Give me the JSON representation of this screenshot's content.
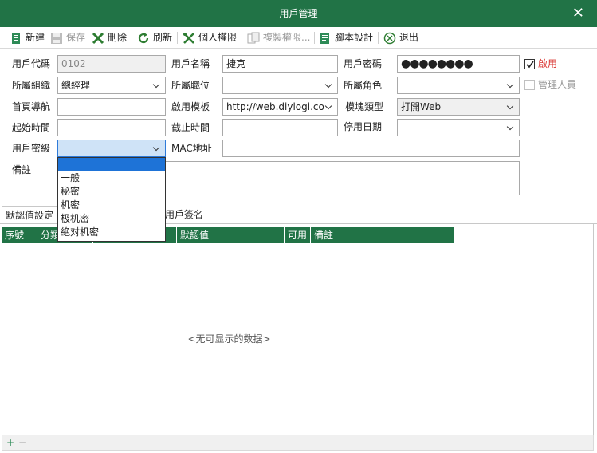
{
  "window": {
    "title": "用戶管理"
  },
  "toolbar": {
    "new": "新建",
    "save": "保存",
    "delete": "刪除",
    "refresh": "刷新",
    "personal_perm": "個人權限",
    "copy_perm": "複製權限...",
    "script_design": "腳本設計",
    "exit": "退出"
  },
  "form": {
    "user_code": {
      "label": "用戶代碼",
      "value": "0102"
    },
    "user_name": {
      "label": "用戶名稱",
      "value": "捷克"
    },
    "password": {
      "label": "用戶密碼",
      "value": "●●●●●●●●"
    },
    "enabled": {
      "label": "啟用",
      "checked": true
    },
    "org": {
      "label": "所屬組織",
      "value": "總經理"
    },
    "position": {
      "label": "所屬職位",
      "value": ""
    },
    "role": {
      "label": "所屬角色",
      "value": ""
    },
    "admin": {
      "label": "管理人員",
      "checked": false
    },
    "home_nav": {
      "label": "首頁導航",
      "value": ""
    },
    "template": {
      "label": "啟用模板",
      "value": "http://web.diylogi.cor"
    },
    "template_type": {
      "label": "模塊類型",
      "value": "打開Web"
    },
    "start_time": {
      "label": "起始時間",
      "value": ""
    },
    "end_time": {
      "label": "截止時間",
      "value": ""
    },
    "disable_date": {
      "label": "停用日期",
      "value": "- -     : :"
    },
    "security_level": {
      "label": "用戶密級",
      "value": ""
    },
    "mac": {
      "label": "MAC地址",
      "value": ""
    },
    "remark": {
      "label": "備註",
      "value": ""
    }
  },
  "security_options": [
    "",
    "一般",
    "秘密",
    "机密",
    "极机密",
    "絶对机密"
  ],
  "tabs": [
    "默認值設定",
    "用戶簽名"
  ],
  "grid": {
    "columns": [
      "序號",
      "分類",
      "",
      "默認值",
      "可用",
      "備註"
    ],
    "empty_text": "<无可显示的数据>"
  },
  "colors": {
    "accent": "#217346",
    "selection": "#1e73d7",
    "checked_red": "#d9302c"
  },
  "icons": [
    "new-doc-icon",
    "save-disk-icon",
    "delete-x-icon",
    "refresh-icon",
    "tools-icon",
    "copy-icon",
    "script-icon",
    "exit-circle-icon",
    "add-icon",
    "remove-icon"
  ]
}
